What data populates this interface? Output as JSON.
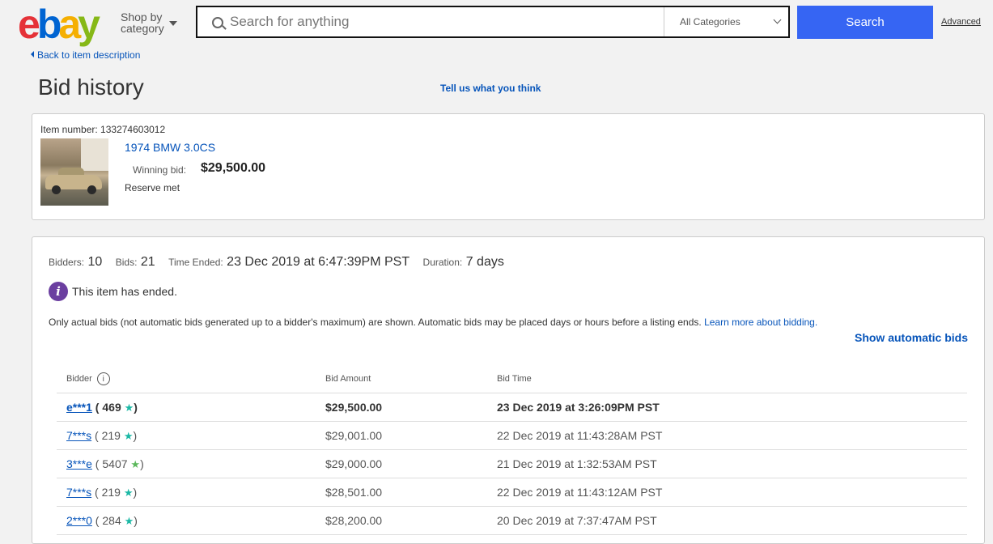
{
  "header": {
    "logo": {
      "e": "e",
      "b": "b",
      "a": "a",
      "y": "y"
    },
    "shop_by_line1": "Shop by",
    "shop_by_line2": "category",
    "search_placeholder": "Search for anything",
    "category_selected": "All Categories",
    "search_button": "Search",
    "advanced_link": "Advanced"
  },
  "nav": {
    "back_link": "Back to item description",
    "page_title": "Bid history",
    "feedback_link": "Tell us what you think"
  },
  "item": {
    "number_label": "Item number:",
    "number": "133274603012",
    "title": "1974 BMW 3.0CS",
    "winning_label": "Winning bid:",
    "winning_bid": "$29,500.00",
    "reserve_status": "Reserve met"
  },
  "stats": {
    "bidders_label": "Bidders:",
    "bidders": "10",
    "bids_label": "Bids:",
    "bids": "21",
    "time_ended_label": "Time Ended:",
    "time_ended": "23 Dec 2019 at 6:47:39PM PST",
    "duration_label": "Duration:",
    "duration": "7 days"
  },
  "notice": {
    "ended_text": "This item has ended.",
    "disclaimer": "Only actual bids (not automatic bids generated up to a bidder's maximum) are shown. Automatic bids may be placed days or hours before a listing ends.",
    "learn_more": "Learn more about bidding.",
    "show_automatic": "Show automatic bids"
  },
  "table": {
    "headers": {
      "bidder": "Bidder",
      "amount": "Bid Amount",
      "time": "Bid Time"
    },
    "rows": [
      {
        "bidder": "e***1",
        "score": "469",
        "star_color": "#1bb8a5",
        "amount": "$29,500.00",
        "time": "23 Dec 2019 at 3:26:09PM PST"
      },
      {
        "bidder": "7***s",
        "score": "219",
        "star_color": "#1bb8a5",
        "amount": "$29,001.00",
        "time": "22 Dec 2019 at 11:43:28AM PST"
      },
      {
        "bidder": "3***e",
        "score": "5407",
        "star_color": "#5cb85c",
        "amount": "$29,000.00",
        "time": "21 Dec 2019 at 1:32:53AM PST"
      },
      {
        "bidder": "7***s",
        "score": "219",
        "star_color": "#1bb8a5",
        "amount": "$28,501.00",
        "time": "22 Dec 2019 at 11:43:12AM PST"
      },
      {
        "bidder": "2***0",
        "score": "284",
        "star_color": "#1bb8a5",
        "amount": "$28,200.00",
        "time": "20 Dec 2019 at 7:37:47AM PST"
      }
    ]
  },
  "colors": {
    "accent": "#3665f3",
    "link": "#0654ba",
    "info_icon": "#6b3fa0"
  }
}
